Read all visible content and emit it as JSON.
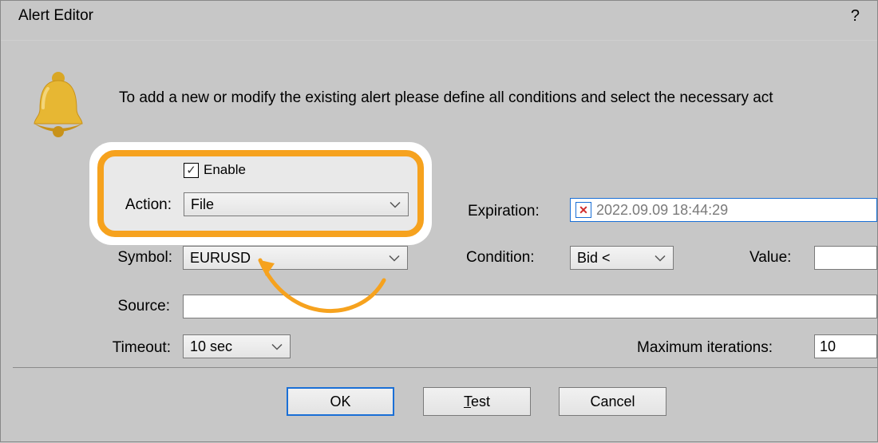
{
  "window": {
    "title": "Alert Editor",
    "help_label": "?",
    "description": "To add a new or modify the existing alert please define all conditions and select the necessary act"
  },
  "enable": {
    "label": "Enable",
    "checked": true
  },
  "action": {
    "label": "Action:",
    "value": "File"
  },
  "expiration": {
    "label": "Expiration:",
    "value": "2022.09.09 18:44:29"
  },
  "symbol": {
    "label": "Symbol:",
    "value": "EURUSD"
  },
  "condition": {
    "label": "Condition:",
    "value": "Bid <"
  },
  "value_field": {
    "label": "Value:",
    "value": ""
  },
  "source": {
    "label": "Source:",
    "value": ""
  },
  "timeout": {
    "label": "Timeout:",
    "value": "10 sec"
  },
  "max_iter": {
    "label": "Maximum iterations:",
    "value": "10"
  },
  "buttons": {
    "ok": "OK",
    "test": "Test",
    "test_prefix": "T",
    "test_rest": "est",
    "cancel": "Cancel"
  },
  "colors": {
    "accent": "#1a6fd6",
    "highlight": "#f6a21e"
  }
}
